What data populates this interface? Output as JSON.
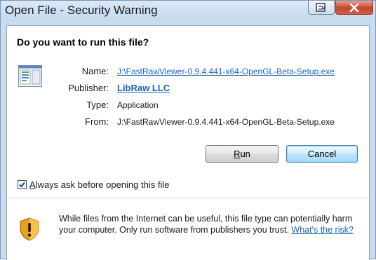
{
  "window": {
    "title": "Open File - Security Warning"
  },
  "dialog": {
    "question": "Do you want to run this file?",
    "fields": {
      "name_label": "Name:",
      "name_value": "J:\\FastRawViewer-0.9.4.441-x64-OpenGL-Beta-Setup.exe",
      "publisher_label": "Publisher:",
      "publisher_value": "LibRaw LLC",
      "type_label": "Type:",
      "type_value": "Application",
      "from_label": "From:",
      "from_value": "J:\\FastRawViewer-0.9.4.441-x64-OpenGL-Beta-Setup.exe"
    },
    "buttons": {
      "run": "Run",
      "cancel": "Cancel"
    },
    "checkbox": {
      "label": "Always ask before opening this file",
      "checked": true
    },
    "warning": {
      "text": "While files from the Internet can be useful, this file type can potentially harm your computer. Only run software from publishers you trust.",
      "link": "What's the risk?"
    }
  },
  "icons": {
    "help": "help-icon",
    "close": "close-icon",
    "file": "application-file-icon",
    "shield": "warning-shield-icon",
    "check": "checkmark-icon"
  },
  "colors": {
    "link": "#1e63b8",
    "frame": "#c9dcf0",
    "close_button": "#c4452c"
  }
}
